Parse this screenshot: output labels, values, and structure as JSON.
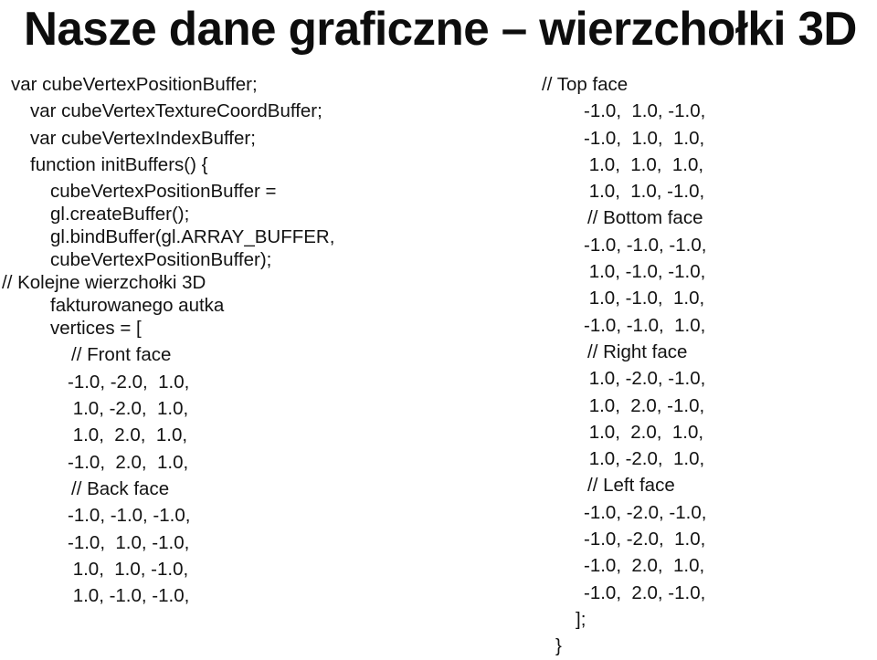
{
  "slide": {
    "title": "Nasze dane graficzne – wierzchołki 3D",
    "background_color": "#ffffff",
    "text_color": "#131313",
    "title_color": "#0d0d0d"
  },
  "code": {
    "left_column": [
      {
        "text": "var cubeVertexPositionBuffer;",
        "indent": 12,
        "style": "normal"
      },
      {
        "text": "var cubeVertexTextureCoordBuffer;",
        "indent": 33,
        "style": "normal"
      },
      {
        "text": "var cubeVertexIndexBuffer;",
        "indent": 33,
        "style": "normal"
      },
      {
        "text": "function initBuffers() {",
        "indent": 33,
        "style": "normal"
      },
      {
        "text": "cubeVertexPositionBuffer =",
        "indent": 55,
        "style": "wrap-head"
      },
      {
        "text": "gl.createBuffer();",
        "indent": 55,
        "style": "wrap-cont"
      },
      {
        "text": "gl.bindBuffer(gl.ARRAY_BUFFER,",
        "indent": 55,
        "style": "wrap-head"
      },
      {
        "text": "cubeVertexPositionBuffer);",
        "indent": 55,
        "style": "wrap-cont"
      },
      {
        "text": "// Kolejne wierzchołki 3D",
        "indent": 2,
        "style": "wrap-head"
      },
      {
        "text": "fakturowanego autka",
        "indent": 55,
        "style": "wrap-cont"
      },
      {
        "text": "vertices = [",
        "indent": 55,
        "style": "normal"
      },
      {
        "text": "// Front face",
        "indent": 78,
        "style": "normal"
      },
      {
        "text": "-1.0, -2.0,  1.0,",
        "indent": 74,
        "style": "normal"
      },
      {
        "text": " 1.0, -2.0,  1.0,",
        "indent": 74,
        "style": "normal"
      },
      {
        "text": " 1.0,  2.0,  1.0,",
        "indent": 74,
        "style": "normal"
      },
      {
        "text": "-1.0,  2.0,  1.0,",
        "indent": 74,
        "style": "normal"
      },
      {
        "text": "// Back face",
        "indent": 78,
        "style": "normal"
      },
      {
        "text": "-1.0, -1.0, -1.0,",
        "indent": 74,
        "style": "normal"
      },
      {
        "text": "-1.0,  1.0, -1.0,",
        "indent": 74,
        "style": "normal"
      },
      {
        "text": " 1.0,  1.0, -1.0,",
        "indent": 74,
        "style": "normal"
      },
      {
        "text": " 1.0, -1.0, -1.0,",
        "indent": 74,
        "style": "normal"
      }
    ],
    "right_column": [
      {
        "text": "// Top face",
        "indent": 0,
        "style": "normal"
      },
      {
        "text": "-1.0,  1.0, -1.0,",
        "indent": 46,
        "style": "normal"
      },
      {
        "text": "-1.0,  1.0,  1.0,",
        "indent": 46,
        "style": "normal"
      },
      {
        "text": " 1.0,  1.0,  1.0,",
        "indent": 46,
        "style": "normal"
      },
      {
        "text": " 1.0,  1.0, -1.0,",
        "indent": 46,
        "style": "normal"
      },
      {
        "text": "// Bottom face",
        "indent": 50,
        "style": "normal"
      },
      {
        "text": "-1.0, -1.0, -1.0,",
        "indent": 46,
        "style": "normal"
      },
      {
        "text": " 1.0, -1.0, -1.0,",
        "indent": 46,
        "style": "normal"
      },
      {
        "text": " 1.0, -1.0,  1.0,",
        "indent": 46,
        "style": "normal"
      },
      {
        "text": "-1.0, -1.0,  1.0,",
        "indent": 46,
        "style": "normal"
      },
      {
        "text": "// Right face",
        "indent": 50,
        "style": "normal"
      },
      {
        "text": " 1.0, -2.0, -1.0,",
        "indent": 46,
        "style": "normal"
      },
      {
        "text": " 1.0,  2.0, -1.0,",
        "indent": 46,
        "style": "normal"
      },
      {
        "text": " 1.0,  2.0,  1.0,",
        "indent": 46,
        "style": "normal"
      },
      {
        "text": " 1.0, -2.0,  1.0,",
        "indent": 46,
        "style": "normal"
      },
      {
        "text": "// Left face",
        "indent": 50,
        "style": "normal"
      },
      {
        "text": "-1.0, -2.0, -1.0,",
        "indent": 46,
        "style": "normal"
      },
      {
        "text": "-1.0, -2.0,  1.0,",
        "indent": 46,
        "style": "normal"
      },
      {
        "text": "-1.0,  2.0,  1.0,",
        "indent": 46,
        "style": "normal"
      },
      {
        "text": "-1.0,  2.0, -1.0,",
        "indent": 46,
        "style": "normal"
      },
      {
        "text": "];",
        "indent": 37,
        "style": "normal"
      },
      {
        "text": "}",
        "indent": 15,
        "style": "normal"
      }
    ]
  }
}
